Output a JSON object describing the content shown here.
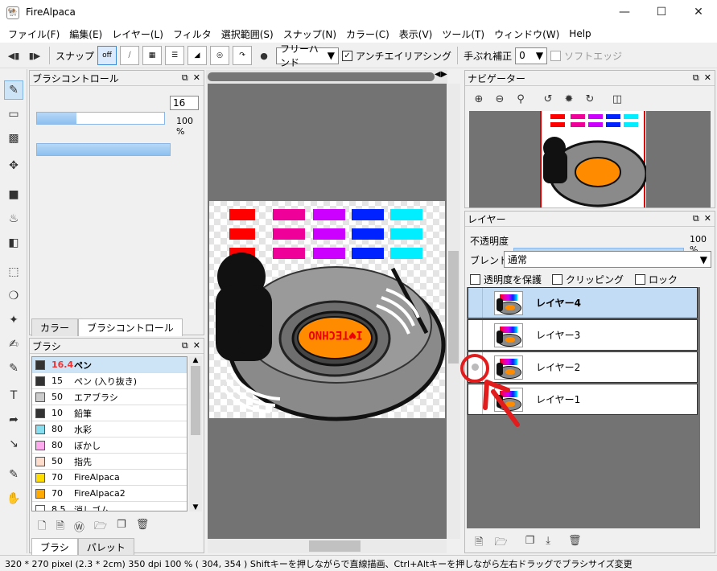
{
  "window": {
    "title": "FireAlpaca"
  },
  "menu": [
    "ファイル(F)",
    "編集(E)",
    "レイヤー(L)",
    "フィルタ",
    "選択範囲(S)",
    "スナップ(N)",
    "カラー(C)",
    "表示(V)",
    "ツール(T)",
    "ウィンドウ(W)",
    "Help"
  ],
  "toolbar": {
    "snap_label": "スナップ",
    "snap_off": "off",
    "mode": "フリーハンド",
    "antialias": "アンチエイリアシング",
    "stabilizer_label": "手ぶれ補正",
    "stabilizer_value": "0",
    "soft_edge": "ソフトエッジ"
  },
  "brush_control": {
    "title": "ブラシコントロール",
    "size_value": "16",
    "opacity_value": "100 %",
    "size_fraction": 0.31,
    "opacity_fraction": 1.0
  },
  "left_tabs": {
    "color": "カラー",
    "brush_control": "ブラシコントロール"
  },
  "brush_panel": {
    "title": "ブラシ",
    "items": [
      {
        "size": "16.4",
        "name": "ペン",
        "color": "#333333",
        "selected": true
      },
      {
        "size": "15",
        "name": "ペン (入り抜き)",
        "color": "#333333"
      },
      {
        "size": "50",
        "name": "エアブラシ",
        "color": "#cccccc"
      },
      {
        "size": "10",
        "name": "鉛筆",
        "color": "#333333"
      },
      {
        "size": "80",
        "name": "水彩",
        "color": "#88ddee"
      },
      {
        "size": "80",
        "name": "ぼかし",
        "color": "#ffaaee"
      },
      {
        "size": "50",
        "name": "指先",
        "color": "#ffddcc"
      },
      {
        "size": "70",
        "name": "FireAlpaca",
        "color": "#ffdd00"
      },
      {
        "size": "70",
        "name": "FireAlpaca2",
        "color": "#ffaa00"
      },
      {
        "size": "8.5",
        "name": "消しゴム",
        "color": "#ffffff"
      }
    ]
  },
  "bottom_tabs": {
    "brush": "ブラシ",
    "palette": "パレット"
  },
  "navigator": {
    "title": "ナビゲーター"
  },
  "layer_panel": {
    "title": "レイヤー",
    "opacity_label": "不透明度",
    "opacity_value": "100 %",
    "opacity_fraction": 1.0,
    "blend_label": "ブレンド",
    "blend_value": "通常",
    "protect": "透明度を保護",
    "clipping": "クリッピング",
    "lock": "ロック",
    "layers": [
      {
        "name": "レイヤー4",
        "selected": true
      },
      {
        "name": "レイヤー3"
      },
      {
        "name": "レイヤー2"
      },
      {
        "name": "レイヤー1"
      }
    ]
  },
  "canvas": {
    "badge_text": "I♥TECHNO"
  },
  "status": {
    "text": "320 * 270 pixel   (2.3 * 2cm)  350 dpi   100 %   ( 304, 354 )   Shiftキーを押しながらで直線描画、Ctrl+Altキーを押しながら左右ドラッグでブラシサイズ変更"
  }
}
